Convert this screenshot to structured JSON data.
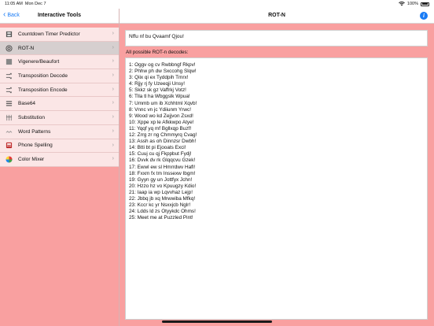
{
  "status_bar": {
    "time": "11:05 AM",
    "date": "Mon Dec 7",
    "battery": "100%",
    "icons": [
      "wifi-icon",
      "battery-icon"
    ]
  },
  "left_nav": {
    "back_label": "Back",
    "title": "Interactive Tools"
  },
  "right_nav": {
    "title": "ROT-N",
    "info_glyph": "i"
  },
  "sidebar": {
    "items": [
      {
        "label": "Countdown Timer Predictor",
        "icon": "timer-icon"
      },
      {
        "label": "ROT-N",
        "icon": "target-icon",
        "selected": true
      },
      {
        "label": "Vigenere/Beaufort",
        "icon": "square-icon"
      },
      {
        "label": "Transposition Decode",
        "icon": "shuffle-icon"
      },
      {
        "label": "Transposition Encode",
        "icon": "shuffle-icon"
      },
      {
        "label": "Base64",
        "icon": "list-icon"
      },
      {
        "label": "Substitution",
        "icon": "substitution-icon"
      },
      {
        "label": "Word Patterns",
        "icon": "pattern-icon"
      },
      {
        "label": "Phone Spelling",
        "icon": "phone-icon"
      },
      {
        "label": "Color Mixer",
        "icon": "color-wheel-icon"
      }
    ]
  },
  "main": {
    "input_value": "Nffu nf bu Qvaamf Qjou!",
    "results_label": "All possible ROT-n decodes:",
    "results": [
      "1: Oggv og cv Rwbbngf Rkpv!",
      "2: Phhw ph dw Sxccohg Slqw!",
      "3: Qiix qi ex Tyddpih Tmrx!",
      "4: Rjjy rj fy Uzeeqji Unsy!",
      "5: Skkz sk gz Vaffrkj Votz!",
      "6: Tlla tl ha Wbggslk Wpua!",
      "7: Ummb um ib Xchhtml Xqvb!",
      "8: Vnnc vn jc Ydiiunm Yrwc!",
      "9: Wood wo kd Zejjvon Zsxd!",
      "10: Xppe xp le Afkkwpo Atye!",
      "11: Yqqf yq mf Bgllxqp Buzf!",
      "12: Zrrg zr ng Chmmyrq Cvag!",
      "13: Assh as oh Dinnzsr Dwbh!",
      "14: Btti bt pi Ejooats Exci!",
      "15: Cuuj cu qj Fkppbut Fydj!",
      "16: Dvvk dv rk Glqqcvu Gzek!",
      "17: Ewwl ew sl Hmrrdwv Hafl!",
      "18: Fxxm fx tm Inssexw Ibgm!",
      "19: Gyyn gy un Jottfyx Jchn!",
      "20: Hzzo hz vo Kpuugzy Kdio!",
      "21: Iaap ia wp Lqvvhaz Lejp!",
      "22: Jbbq jb xq Mrwwiba Mfkq!",
      "23: Kccr kc yr Nsxxjcb Nglr!",
      "24: Ldds ld zs Otyykdc Ohms!",
      "25: Meet me at Puzzled Pint!"
    ]
  },
  "colors": {
    "background": "#f9a0a0",
    "sidebar_item": "#fbe6e6",
    "sidebar_selected": "#d6cfcf",
    "accent": "#1a7cf5"
  }
}
